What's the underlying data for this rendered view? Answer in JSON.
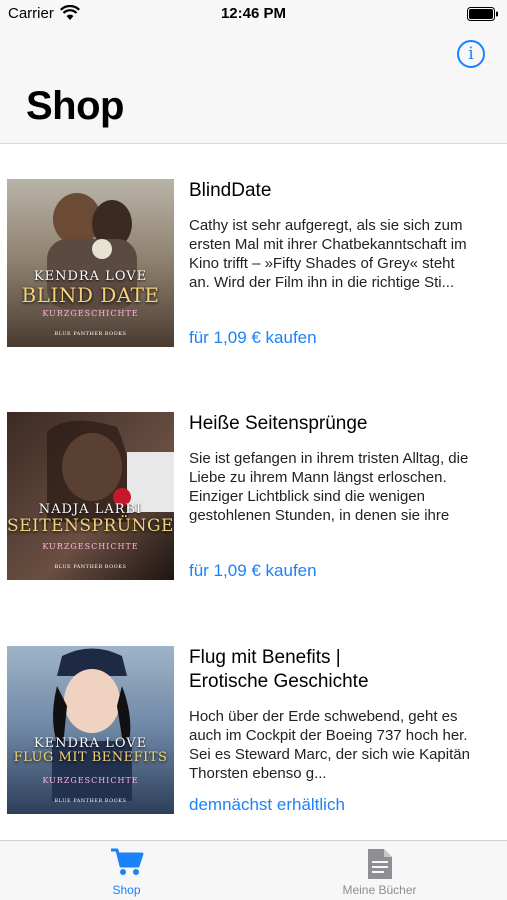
{
  "status_bar": {
    "carrier": "Carrier",
    "time": "12:46 PM"
  },
  "nav": {
    "title": "Shop",
    "info_icon": "info-icon",
    "info_glyph": "i"
  },
  "books": [
    {
      "title": "BlindDate",
      "description": "Cathy ist sehr aufgeregt, als sie sich zum ersten Mal mit ihrer Chatbekanntschaft im Kino trifft – »Fifty Shades of Grey« steht an. Wird der Film ihn in die richtige Sti...",
      "action": "für 1,09 € kaufen",
      "cover": {
        "author": "KENDRA LOVE",
        "title": "BLIND DATE",
        "subtitle": "KURZGESCHICHTE",
        "publisher": "BLUE PANTHER BOOKS"
      }
    },
    {
      "title": "Heiße Seitensprünge",
      "description": "Sie ist gefangen in ihrem tristen Alltag, die Liebe zu ihrem Mann längst erloschen. Einziger Lichtblick sind die wenigen gestohlenen Stunden, in denen sie ihre angesta...",
      "action": "für 1,09 € kaufen",
      "cover": {
        "author": "NADJA LARBI",
        "title": "SEITENSPRÜNGE",
        "subtitle": "KURZGESCHICHTE",
        "publisher": "BLUE PANTHER BOOKS"
      }
    },
    {
      "title": "Flug mit Benefits | Erotische Geschichte",
      "description": "Hoch über der Erde schwebend, geht es auch im Cockpit der Boeing 737 hoch her. Sei es Steward Marc, der sich wie Kapitän Thorsten ebenso g...",
      "action": "demnächst erhältlich",
      "cover": {
        "author": "KENDRA LOVE",
        "title": "FLUG MIT BENEFITS",
        "subtitle": "KURZGESCHICHTE",
        "publisher": "BLUE PANTHER BOOKS"
      }
    }
  ],
  "tabs": [
    {
      "label": "Shop",
      "icon": "cart-icon",
      "active": true
    },
    {
      "label": "Meine Bücher",
      "icon": "document-icon",
      "active": false
    }
  ],
  "colors": {
    "accent": "#1a82fb",
    "inactive": "#8e8e93",
    "bar_background": "#f7f7f7"
  }
}
